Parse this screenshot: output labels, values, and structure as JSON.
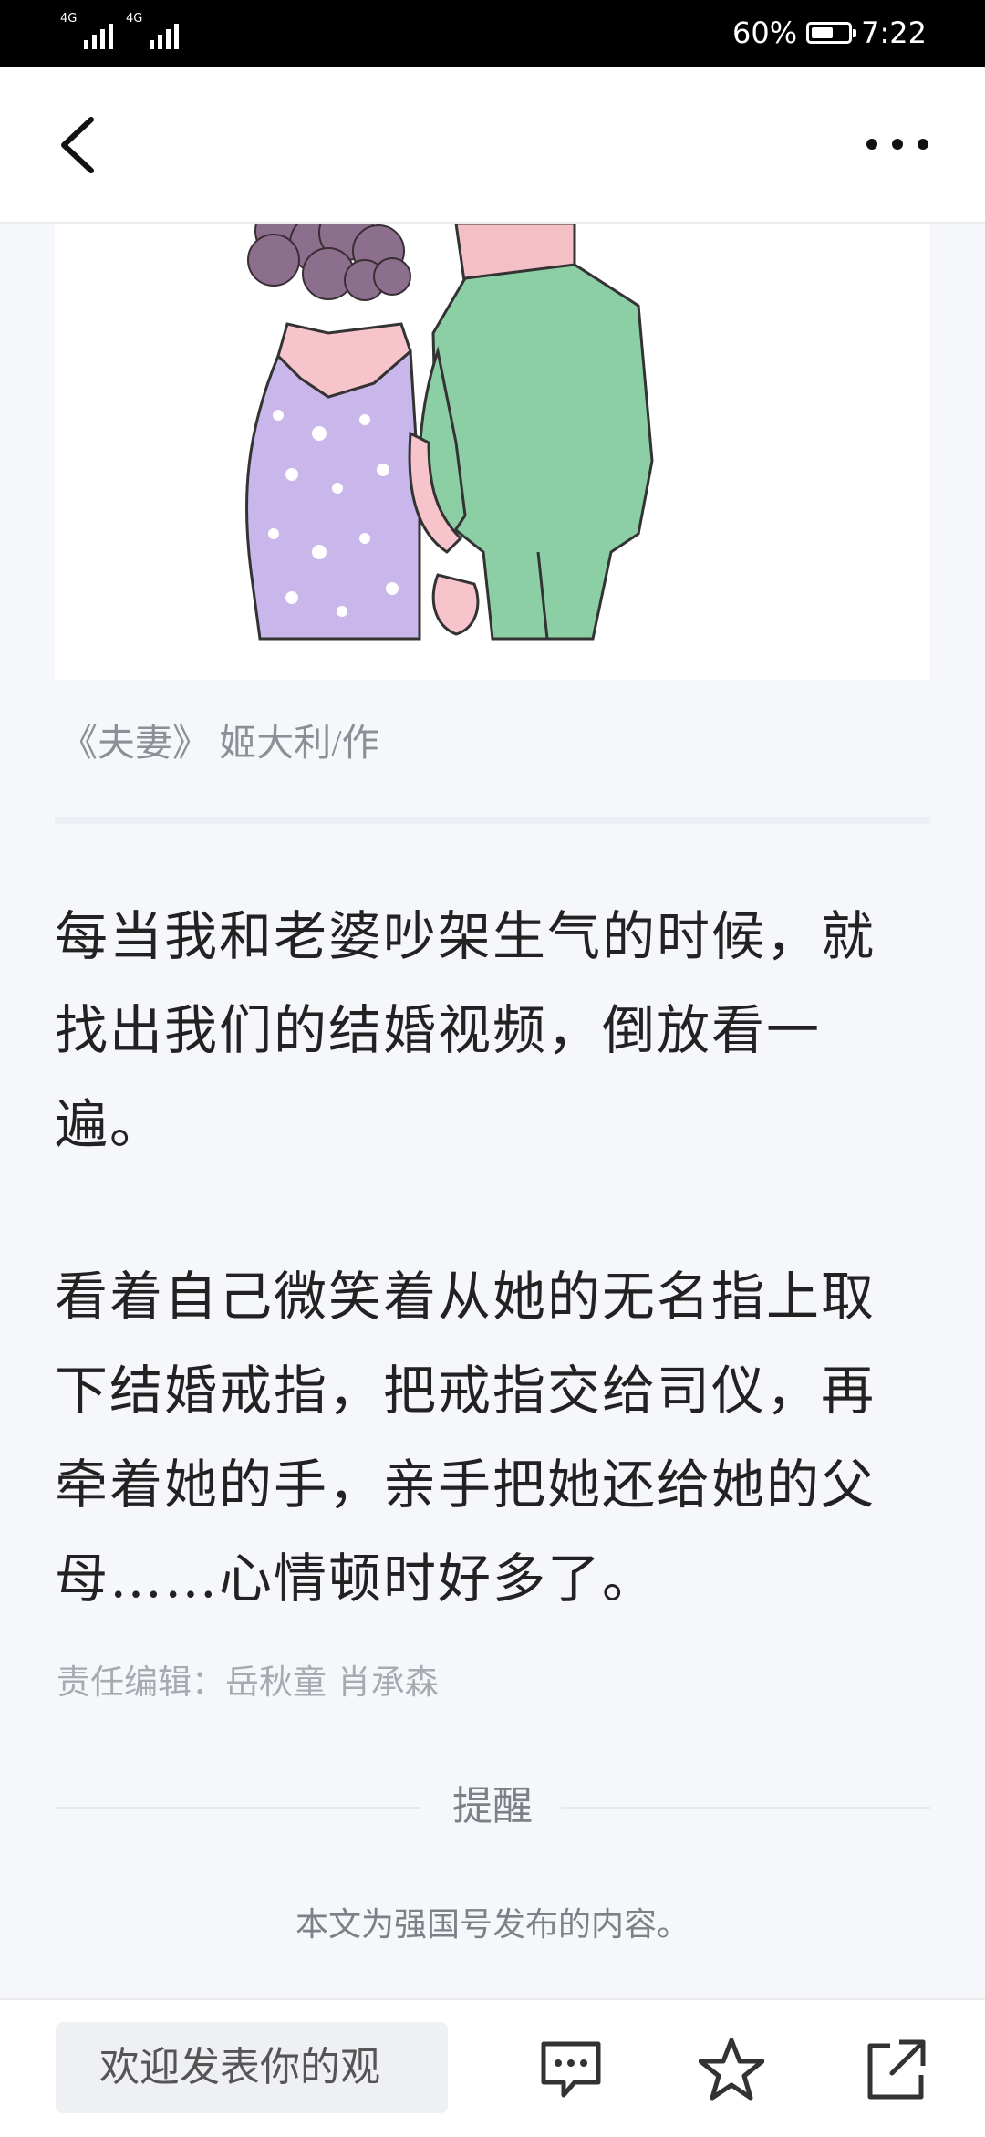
{
  "status_bar": {
    "signal_labels": [
      "4G",
      "4G"
    ],
    "battery_percent_text": "60%",
    "battery_level": 0.6,
    "time": "7:22"
  },
  "header": {
    "back_icon": "chevron-left-icon",
    "more_icon": "more-dots-icon"
  },
  "article": {
    "caption": "《夫妻》 姬大利/作",
    "paragraphs": [
      [
        "每当我和老婆吵架生气的时候，就",
        "找出我们的结婚视频，倒放看一",
        "遍。"
      ],
      [
        "看着自己微笑着从她的无名指上取",
        "下结婚戒指，把戒指交给司仪，再",
        "牵着她的手，亲手把她还给她的父",
        "母……心情顿时好多了。"
      ]
    ],
    "editor": "责任编辑：岳秋童 肖承森",
    "notice_title": "提醒",
    "notice_body": "本文为强国号发布的内容。"
  },
  "bottom_bar": {
    "comment_placeholder": "欢迎发表你的观",
    "icons": [
      "comment-icon",
      "star-icon",
      "share-icon"
    ]
  },
  "colors": {
    "page_bg": "#f6f7fb",
    "text_primary": "#222222",
    "text_muted": "#8d8f96"
  }
}
